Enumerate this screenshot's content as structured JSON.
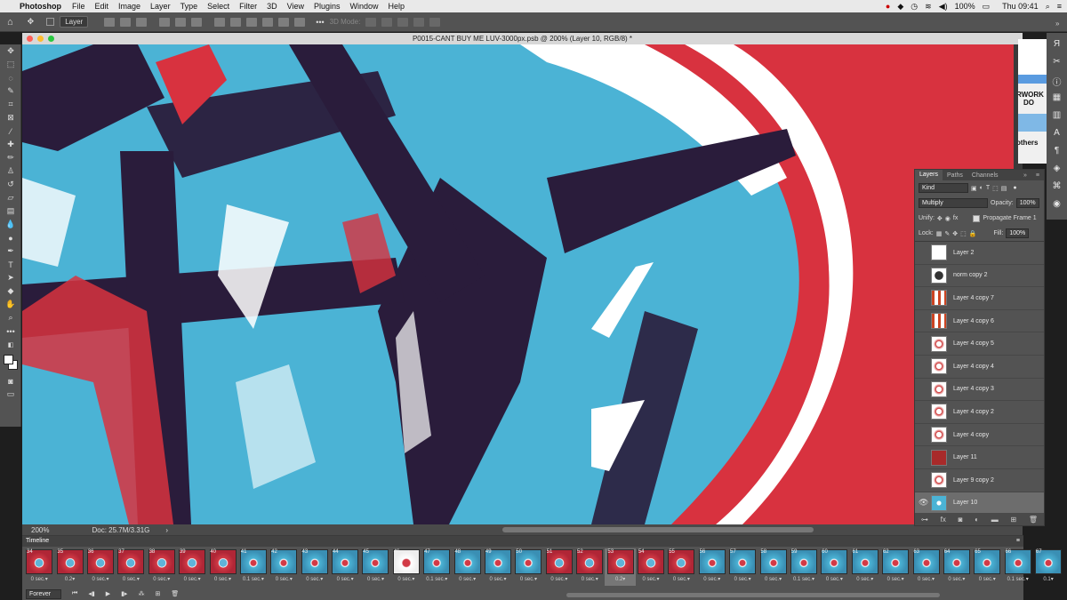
{
  "menubar": {
    "app_name": "Photoshop",
    "items": [
      "File",
      "Edit",
      "Image",
      "Layer",
      "Type",
      "Select",
      "Filter",
      "3D",
      "View",
      "Plugins",
      "Window",
      "Help"
    ],
    "battery": "100%",
    "clock": "Thu 09:41"
  },
  "options_bar": {
    "auto_select_value": "Layer",
    "three_d_mode": "3D Mode:"
  },
  "document": {
    "title": "P0015-CANT BUY ME LUV-3000px.psb @ 200% (Layer 10, RGB/8) *",
    "zoom": "200%",
    "doc_info": "Doc: 25.7M/3.31G"
  },
  "artboard_text": [
    "RWORK",
    "DO",
    "others"
  ],
  "layers_panel": {
    "tabs": [
      "Layers",
      "Paths",
      "Channels"
    ],
    "filter_kind": "Kind",
    "blend_mode": "Multiply",
    "opacity_label": "Opacity:",
    "opacity": "100%",
    "unify_label": "Unify:",
    "propagate_label": "Propagate Frame 1",
    "lock_label": "Lock:",
    "fill_label": "Fill:",
    "fill": "100%",
    "layers": [
      {
        "name": "Layer 2",
        "thumb": "blank"
      },
      {
        "name": "norm copy 2",
        "thumb": "coin"
      },
      {
        "name": "Layer 4 copy 7",
        "thumb": "redbars"
      },
      {
        "name": "Layer 4 copy 6",
        "thumb": "redbars"
      },
      {
        "name": "Layer 4 copy 5",
        "thumb": "redheart"
      },
      {
        "name": "Layer 4 copy 4",
        "thumb": "redheart"
      },
      {
        "name": "Layer 4 copy 3",
        "thumb": "redheart"
      },
      {
        "name": "Layer 4 copy 2",
        "thumb": "redheart"
      },
      {
        "name": "Layer 4 copy",
        "thumb": "redheart"
      },
      {
        "name": "Layer 11",
        "thumb": "solidred"
      },
      {
        "name": "Layer 9 copy 2",
        "thumb": "redheart"
      },
      {
        "name": "Layer 10",
        "thumb": "blue"
      }
    ],
    "selected_layer": "Layer 10"
  },
  "timeline": {
    "title": "Timeline",
    "loop": "Forever",
    "frames": [
      {
        "n": "34",
        "d": "0 sec.",
        "t": "red"
      },
      {
        "n": "35",
        "d": "0.2",
        "t": "red"
      },
      {
        "n": "36",
        "d": "0 sec.",
        "t": "red"
      },
      {
        "n": "37",
        "d": "0 sec.",
        "t": "red"
      },
      {
        "n": "38",
        "d": "0 sec.",
        "t": "red"
      },
      {
        "n": "39",
        "d": "0 sec.",
        "t": "red"
      },
      {
        "n": "40",
        "d": "0 sec.",
        "t": "red"
      },
      {
        "n": "41",
        "d": "0.1 sec.",
        "t": "blue"
      },
      {
        "n": "42",
        "d": "0 sec.",
        "t": "blue"
      },
      {
        "n": "43",
        "d": "0 sec.",
        "t": "blue"
      },
      {
        "n": "44",
        "d": "0 sec.",
        "t": "blue"
      },
      {
        "n": "45",
        "d": "0 sec.",
        "t": "blue"
      },
      {
        "n": "46",
        "d": "0 sec.",
        "t": "white"
      },
      {
        "n": "47",
        "d": "0.1 sec.",
        "t": "blue"
      },
      {
        "n": "48",
        "d": "0 sec.",
        "t": "blue"
      },
      {
        "n": "49",
        "d": "0 sec.",
        "t": "blue"
      },
      {
        "n": "50",
        "d": "0 sec.",
        "t": "blue"
      },
      {
        "n": "51",
        "d": "0 sec.",
        "t": "red"
      },
      {
        "n": "52",
        "d": "0 sec.",
        "t": "red"
      },
      {
        "n": "53",
        "d": "0.2",
        "t": "red"
      },
      {
        "n": "54",
        "d": "0 sec.",
        "t": "red"
      },
      {
        "n": "55",
        "d": "0 sec.",
        "t": "red"
      },
      {
        "n": "56",
        "d": "0 sec.",
        "t": "blue"
      },
      {
        "n": "57",
        "d": "0 sec.",
        "t": "blue"
      },
      {
        "n": "58",
        "d": "0 sec.",
        "t": "blue"
      },
      {
        "n": "59",
        "d": "0.1 sec.",
        "t": "blue"
      },
      {
        "n": "60",
        "d": "0 sec.",
        "t": "blue"
      },
      {
        "n": "61",
        "d": "0 sec.",
        "t": "blue"
      },
      {
        "n": "62",
        "d": "0 sec.",
        "t": "blue"
      },
      {
        "n": "63",
        "d": "0 sec.",
        "t": "blue"
      },
      {
        "n": "64",
        "d": "0 sec.",
        "t": "blue"
      },
      {
        "n": "65",
        "d": "0 sec.",
        "t": "blue"
      },
      {
        "n": "66",
        "d": "0.1 sec.",
        "t": "blue"
      },
      {
        "n": "67",
        "d": "0.1",
        "t": "blue"
      }
    ],
    "selected_frame": "53"
  },
  "colors": {
    "canvas_blue": "#4bb3d5",
    "canvas_red": "#d8323f",
    "canvas_navy": "#2a1c3b",
    "ui_panel": "#535353"
  }
}
